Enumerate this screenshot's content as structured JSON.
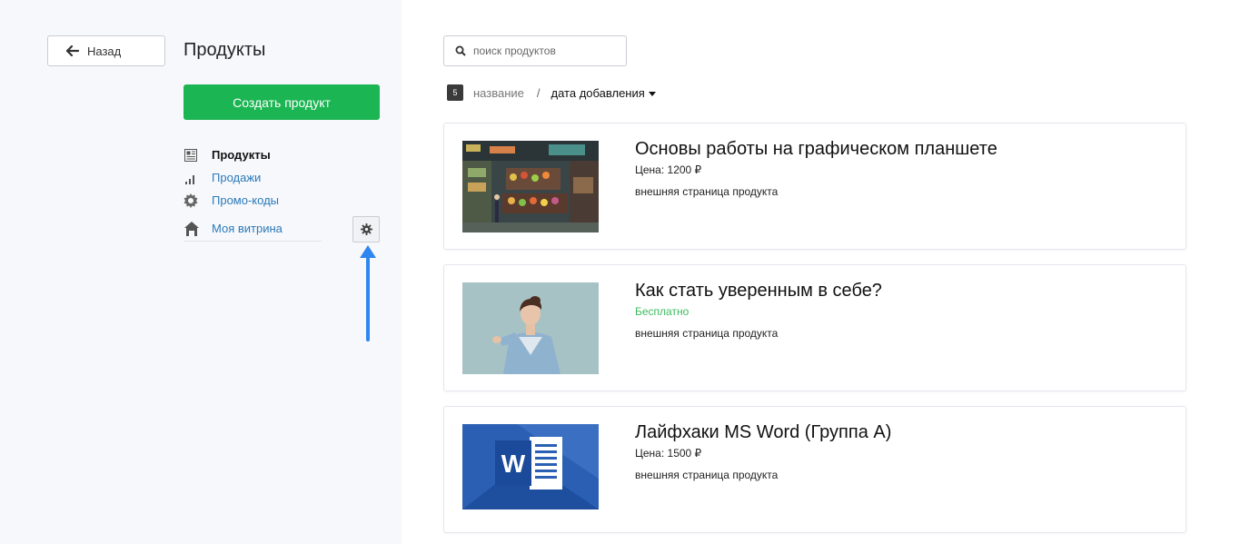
{
  "sidebar": {
    "back_label": "Назад",
    "title": "Продукты",
    "create_label": "Создать продукт",
    "nav": [
      {
        "label": "Продукты",
        "icon": "products-list-icon",
        "active": true
      },
      {
        "label": "Продажи",
        "icon": "bar-chart-icon",
        "active": false
      },
      {
        "label": "Промо-коды",
        "icon": "promo-badge-icon",
        "active": false
      }
    ],
    "showcase_label": "Моя витрина",
    "showcase_icon": "storefront-icon",
    "settings_icon": "gear-icon"
  },
  "search": {
    "placeholder": "поиск продуктов",
    "value": ""
  },
  "sort": {
    "count": "5",
    "by_name": "название",
    "separator": "/",
    "by_date": "дата добавления"
  },
  "products": [
    {
      "title": "Основы работы на графическом планшете",
      "price": "Цена: 1200 ₽",
      "free": false,
      "link": "внешняя страница продукта"
    },
    {
      "title": "Как стать уверенным в себе?",
      "price": "Бесплатно",
      "free": true,
      "link": "внешняя страница продукта"
    },
    {
      "title": "Лайфхаки MS Word (Группа А)",
      "price": "Цена: 1500 ₽",
      "free": false,
      "link": "внешняя страница продукта"
    }
  ],
  "colors": {
    "accent_green": "#1cb553",
    "link_blue": "#2a7ab8",
    "free_green": "#3dbb5e",
    "arrow_blue": "#2f86f0"
  }
}
